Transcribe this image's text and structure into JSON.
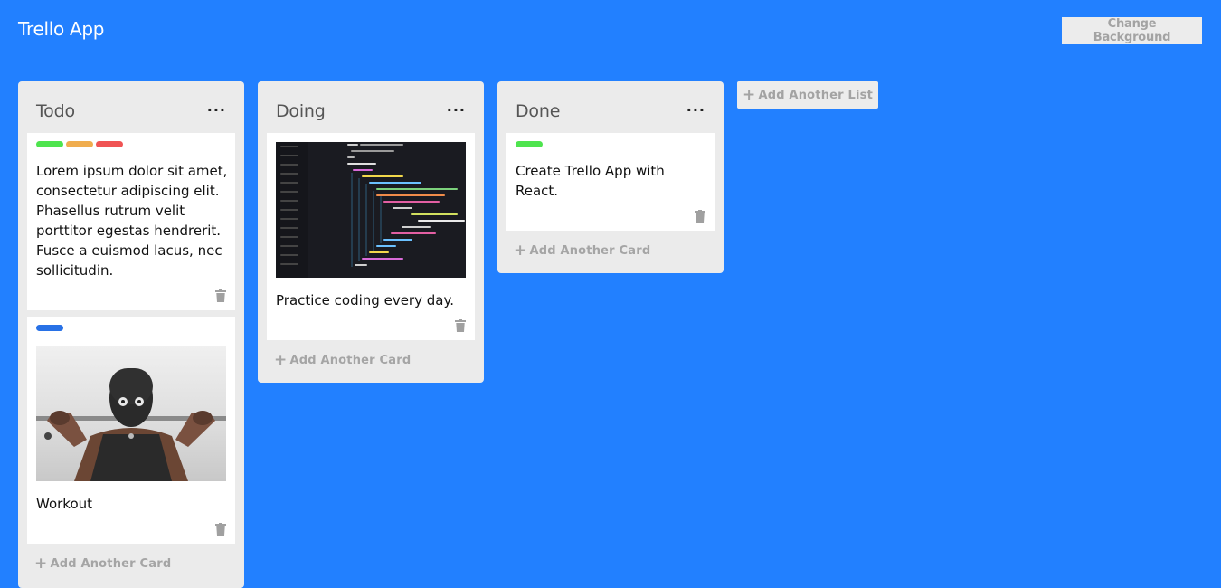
{
  "app": {
    "title": "Trello App",
    "change_background_label": "Change Background"
  },
  "colors": {
    "background": "#2280ff",
    "label_green": "#4ee44e",
    "label_orange": "#f0ad4e",
    "label_red": "#f05454",
    "label_blue": "#2871e6"
  },
  "icons": {
    "menu": "ellipsis-icon",
    "delete": "trash-icon",
    "add": "plus-icon"
  },
  "lists": [
    {
      "title": "Todo",
      "menu": "...",
      "add_card_label": "Add Another Card",
      "cards": [
        {
          "labels": [
            "green",
            "orange",
            "red"
          ],
          "text": "Lorem ipsum dolor sit amet, consectetur adipiscing elit. Phasellus rutrum velit porttitor egestas hendrerit. Fusce a euismod lacus, nec sollicitudin."
        },
        {
          "labels": [
            "blue"
          ],
          "image": "workout-photo",
          "text": "Workout"
        }
      ]
    },
    {
      "title": "Doing",
      "menu": "...",
      "add_card_label": "Add Another Card",
      "cards": [
        {
          "labels": [],
          "image": "code-screenshot",
          "text": "Practice coding every day."
        }
      ]
    },
    {
      "title": "Done",
      "menu": "...",
      "add_card_label": "Add Another Card",
      "cards": [
        {
          "labels": [
            "green"
          ],
          "text": "Create Trello App with React."
        }
      ]
    }
  ],
  "add_list_label": "Add Another List"
}
